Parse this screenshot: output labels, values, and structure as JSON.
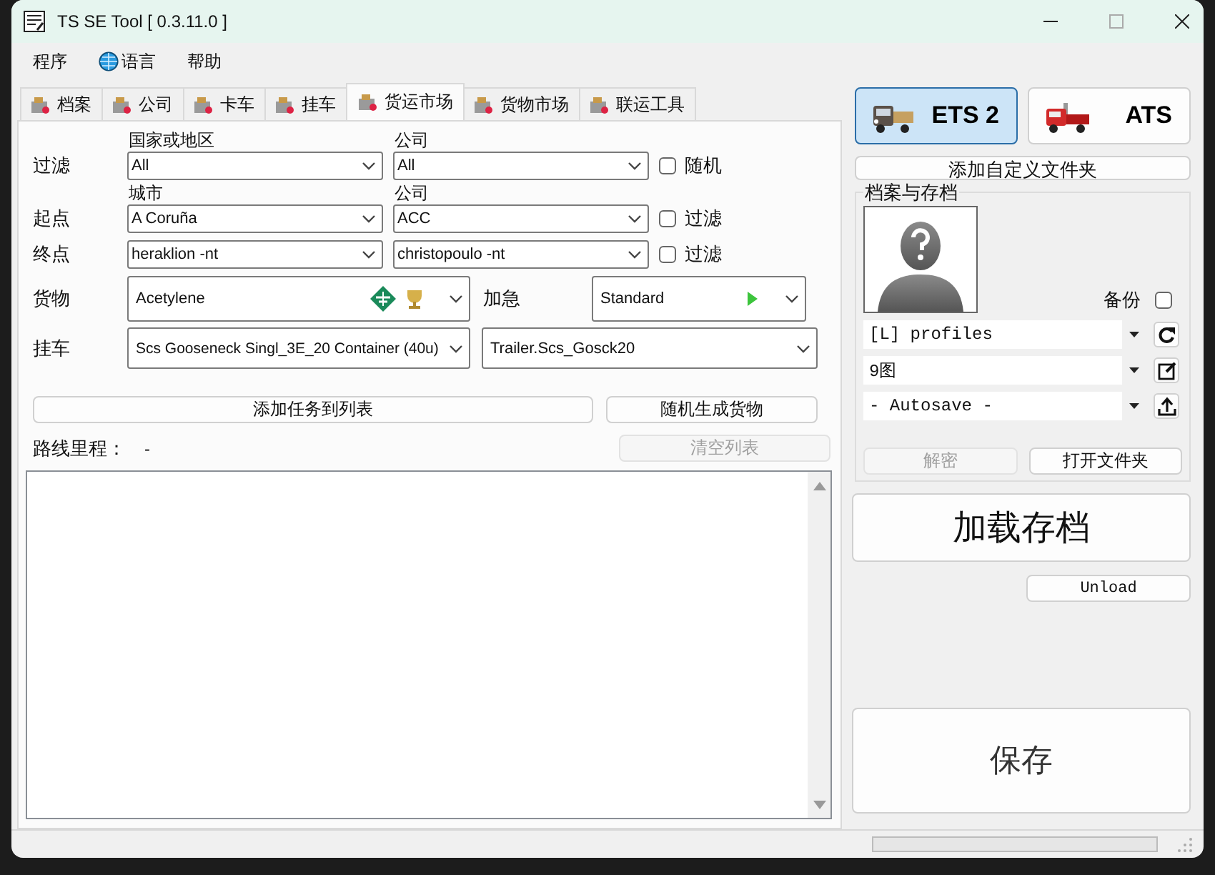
{
  "window": {
    "title": "TS SE Tool [ 0.3.11.0 ]"
  },
  "menu": [
    {
      "label": "程序",
      "kind": "plain"
    },
    {
      "label": "语言",
      "kind": "globe"
    },
    {
      "label": "帮助",
      "kind": "plain"
    }
  ],
  "tabs": [
    {
      "label": "档案",
      "selected": false
    },
    {
      "label": "公司",
      "selected": false
    },
    {
      "label": "卡车",
      "selected": false
    },
    {
      "label": "挂车",
      "selected": false
    },
    {
      "label": "货运市场",
      "selected": true
    },
    {
      "label": "货物市场",
      "selected": false
    },
    {
      "label": "联运工具",
      "selected": false
    }
  ],
  "form": {
    "filter": {
      "label": "过滤",
      "fields": [
        {
          "caption": "国家或地区",
          "value": "All"
        },
        {
          "caption": "公司",
          "value": "All"
        }
      ],
      "checkbox": {
        "label": "随机",
        "checked": false
      }
    },
    "origin": {
      "label": "起点",
      "fields": [
        {
          "caption": "城市",
          "value": "A Coruña"
        },
        {
          "caption": "公司",
          "value": "ACC"
        }
      ],
      "checkbox": {
        "label": "过滤",
        "checked": false
      }
    },
    "destination": {
      "label": "终点",
      "fields": [
        {
          "value": "heraklion -nt"
        },
        {
          "value": "christopoulo -nt"
        }
      ],
      "checkbox": {
        "label": "过滤",
        "checked": false
      }
    },
    "cargo": {
      "label": "货物",
      "value": "Acetylene"
    },
    "urgency": {
      "label": "加急",
      "value": "Standard"
    },
    "trailer": {
      "label": "挂车",
      "fields": [
        {
          "value": "Scs Gooseneck Singl_3E_20 Container (40u)"
        },
        {
          "value": "Trailer.Scs_Gosck20"
        }
      ]
    },
    "add_job_button": {
      "label": "添加任务到列表",
      "disabled": false
    },
    "random_cargo_button": {
      "label": "随机生成货物",
      "disabled": false
    },
    "distance": {
      "label": "路线里程：",
      "value": "-"
    },
    "clear_list_button": {
      "label": "清空列表",
      "disabled": true
    }
  },
  "games": [
    {
      "label": "ETS 2",
      "selected": true
    },
    {
      "label": "ATS",
      "selected": false
    }
  ],
  "add_folder_button": {
    "label": "添加自定义文件夹"
  },
  "profiles": {
    "title": "档案与存档",
    "backup": {
      "label": "备份",
      "checked": false
    },
    "selects": [
      {
        "value": "[L] profiles",
        "kind": "refresh"
      },
      {
        "value": "9图",
        "kind": "edit"
      },
      {
        "value": "- Autosave -",
        "kind": "export"
      }
    ],
    "decrypt_button": {
      "label": "解密",
      "disabled": true
    },
    "open_folder_button": {
      "label": "打开文件夹",
      "disabled": false
    }
  },
  "load_button": {
    "label": "加载存档"
  },
  "unload_button": {
    "label": "Unload"
  },
  "save_button": {
    "label": "保存"
  },
  "status_bar": {
    "progress": {
      "level": 0
    }
  }
}
